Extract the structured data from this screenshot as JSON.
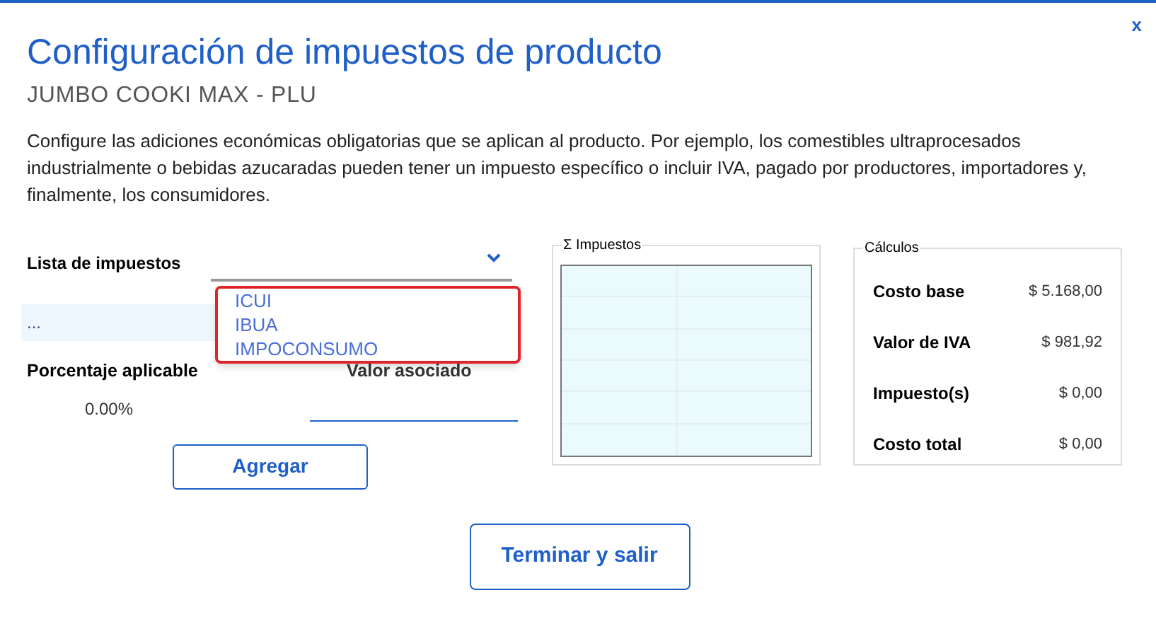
{
  "window": {
    "title": "Configuración de impuestos de producto",
    "subtitle": "JUMBO COOKI MAX - PLU",
    "close": "x"
  },
  "description": "Configure las adiciones económicas obligatorias que se aplican al producto. Por ejemplo, los comestibles ultraprocesados industrialmente o bebidas azucaradas pueden tener un impuesto específico o incluir IVA, pagado por productores, importadores y, finalmente, los consumidores.",
  "tax_list": {
    "label": "Lista de impuestos",
    "expanded": true,
    "options": [
      "ICUI",
      "IBUA",
      "IMPOCONSUMO"
    ],
    "selected_row": "..."
  },
  "percentage": {
    "label": "Porcentaje aplicable",
    "value": "0.00%"
  },
  "associated_value": {
    "label": "Valor asociado"
  },
  "add_button": "Agregar",
  "taxes_group": {
    "title": "Σ Impuestos"
  },
  "calculations": {
    "title": "Cálculos",
    "rows": [
      {
        "label": "Costo base",
        "value": "$ 5.168,00"
      },
      {
        "label": "Valor de IVA",
        "value": "$ 981,92"
      },
      {
        "label": "Impuesto(s)",
        "value": "$ 0,00"
      },
      {
        "label": "Costo total",
        "value": "$ 0,00"
      }
    ]
  },
  "finish_button": "Terminar y salir"
}
